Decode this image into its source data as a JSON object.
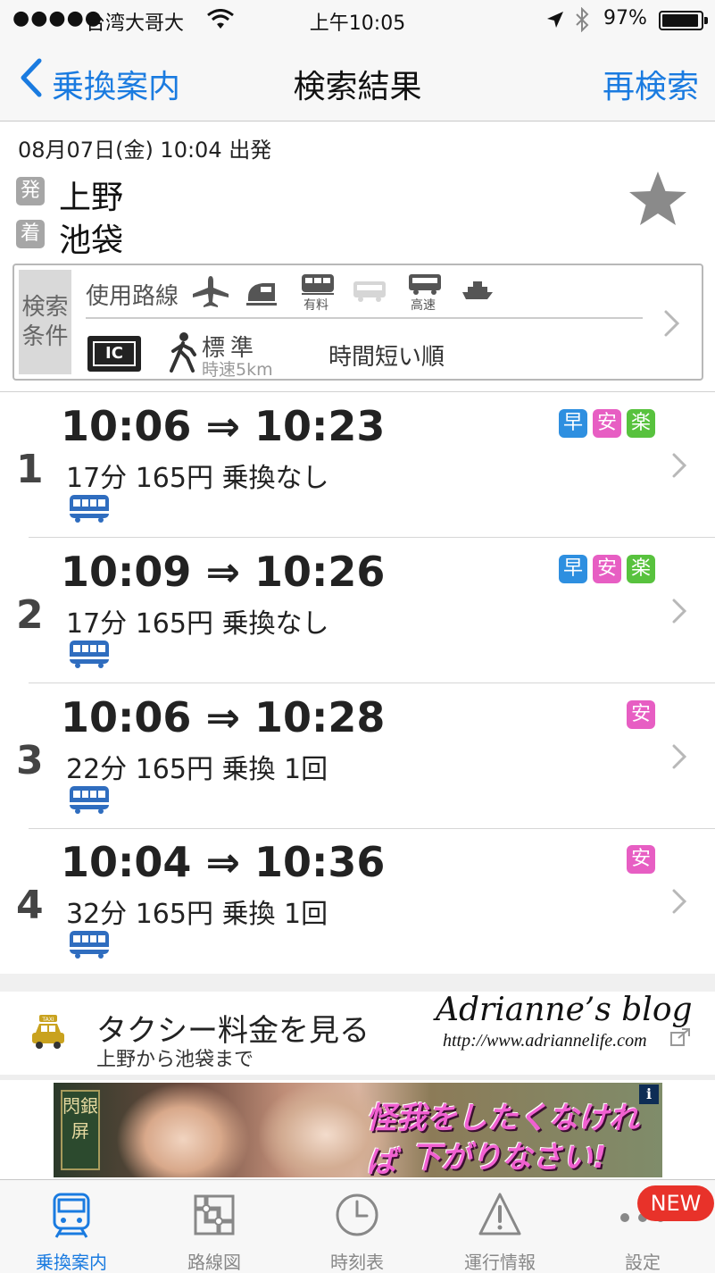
{
  "status_bar": {
    "signal": "●●●●●",
    "carrier": "台湾大哥大",
    "time": "上午10:05",
    "battery": "97%"
  },
  "nav": {
    "back_label": "乗換案内",
    "title": "検索結果",
    "research_label": "再検索"
  },
  "query": {
    "datetime": "08月07日(金) 10:04 出発",
    "depart_badge": "発",
    "depart_station": "上野",
    "arrive_badge": "着",
    "arrive_station": "池袋"
  },
  "conditions": {
    "label": "検索条件",
    "routes_label": "使用路線",
    "icon_caption_paid": "有料",
    "icon_caption_express": "高速",
    "ic_label": "IC",
    "walk_label": "標準",
    "walk_speed": "時速5km",
    "sort_order": "時間短い順"
  },
  "routes": [
    {
      "number": "1",
      "times": "10:06 ⇒ 10:23",
      "info": "17分 165円 乗換なし",
      "tags": [
        "早",
        "安",
        "楽"
      ]
    },
    {
      "number": "2",
      "times": "10:09 ⇒ 10:26",
      "info": "17分 165円 乗換なし",
      "tags": [
        "早",
        "安",
        "楽"
      ]
    },
    {
      "number": "3",
      "times": "10:06 ⇒ 10:28",
      "info": "22分 165円 乗換 1回",
      "tags": [
        "安"
      ]
    },
    {
      "number": "4",
      "times": "10:04 ⇒ 10:36",
      "info": "32分 165円 乗換 1回",
      "tags": [
        "安"
      ]
    }
  ],
  "taxi": {
    "title": "タクシー料金を見る",
    "subtitle": "上野から池袋まで",
    "icon_text": "TAXI"
  },
  "watermark": {
    "name": "Adrianne’s blog",
    "url": "http://www.adriannelife.com"
  },
  "ad": {
    "side_text": "閃銀屏",
    "line1": "怪我をしたくなければ",
    "line2": "下がりなさい!",
    "info": "i"
  },
  "tabs": [
    {
      "label": "乗換案内",
      "active": true
    },
    {
      "label": "路線図",
      "active": false
    },
    {
      "label": "時刻表",
      "active": false
    },
    {
      "label": "運行情報",
      "active": false
    },
    {
      "label": "設定",
      "active": false
    }
  ],
  "new_badge": "NEW",
  "colors": {
    "accent": "#1a7be0",
    "tag_fast": "#2e8fe0",
    "tag_cheap": "#e75ec3",
    "tag_easy": "#58c23e",
    "badge_new": "#e8322a"
  }
}
